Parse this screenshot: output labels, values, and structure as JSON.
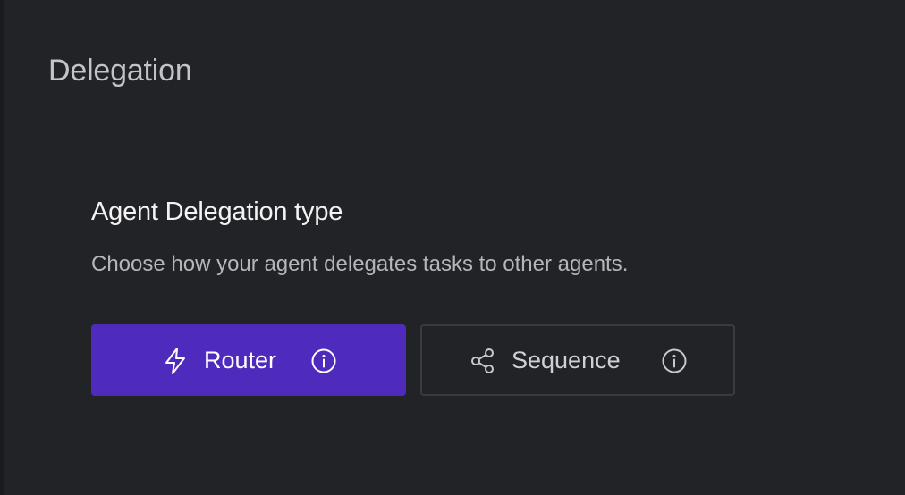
{
  "page": {
    "title": "Delegation"
  },
  "section": {
    "title": "Agent Delegation type",
    "description": "Choose how your agent delegates tasks to other agents."
  },
  "options": [
    {
      "label": "Router",
      "icon": "lightning-bolt-icon",
      "info_icon": "info-circle-icon",
      "selected": true,
      "color": "#4f2bbd"
    },
    {
      "label": "Sequence",
      "icon": "share-nodes-icon",
      "info_icon": "info-circle-icon",
      "selected": false,
      "color": "#3a3b40"
    }
  ],
  "colors": {
    "background": "#222327",
    "accent": "#4f2bbd"
  }
}
